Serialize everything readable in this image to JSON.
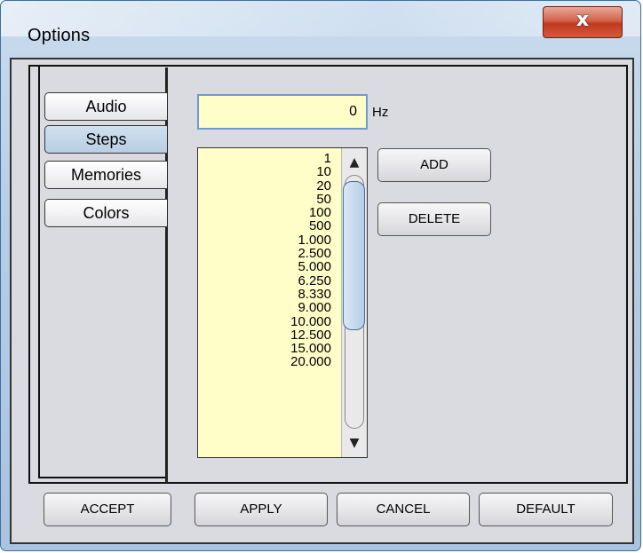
{
  "window": {
    "title": "Options",
    "close_label": "x"
  },
  "tabs": [
    {
      "label": "Audio",
      "active": false
    },
    {
      "label": "Steps",
      "active": true
    },
    {
      "label": "Memories",
      "active": false
    },
    {
      "label": "Colors",
      "active": false
    }
  ],
  "steps_panel": {
    "frequency_value": "0",
    "frequency_unit": "Hz",
    "step_list": [
      "1",
      "10",
      "20",
      "50",
      "100",
      "500",
      "1.000",
      "2.500",
      "5.000",
      "6.250",
      "8.330",
      "9.000",
      "10.000",
      "12.500",
      "15.000",
      "20.000"
    ],
    "add_label": "ADD",
    "delete_label": "DELETE",
    "scroll_up_icon": "▲",
    "scroll_down_icon": "▼"
  },
  "footer": {
    "accept_label": "ACCEPT",
    "apply_label": "APPLY",
    "cancel_label": "CANCEL",
    "default_label": "DEFAULT"
  },
  "colors": {
    "input_background": "#fffec8",
    "close_button": "#c0391f",
    "active_tab": "#b9cee3"
  }
}
